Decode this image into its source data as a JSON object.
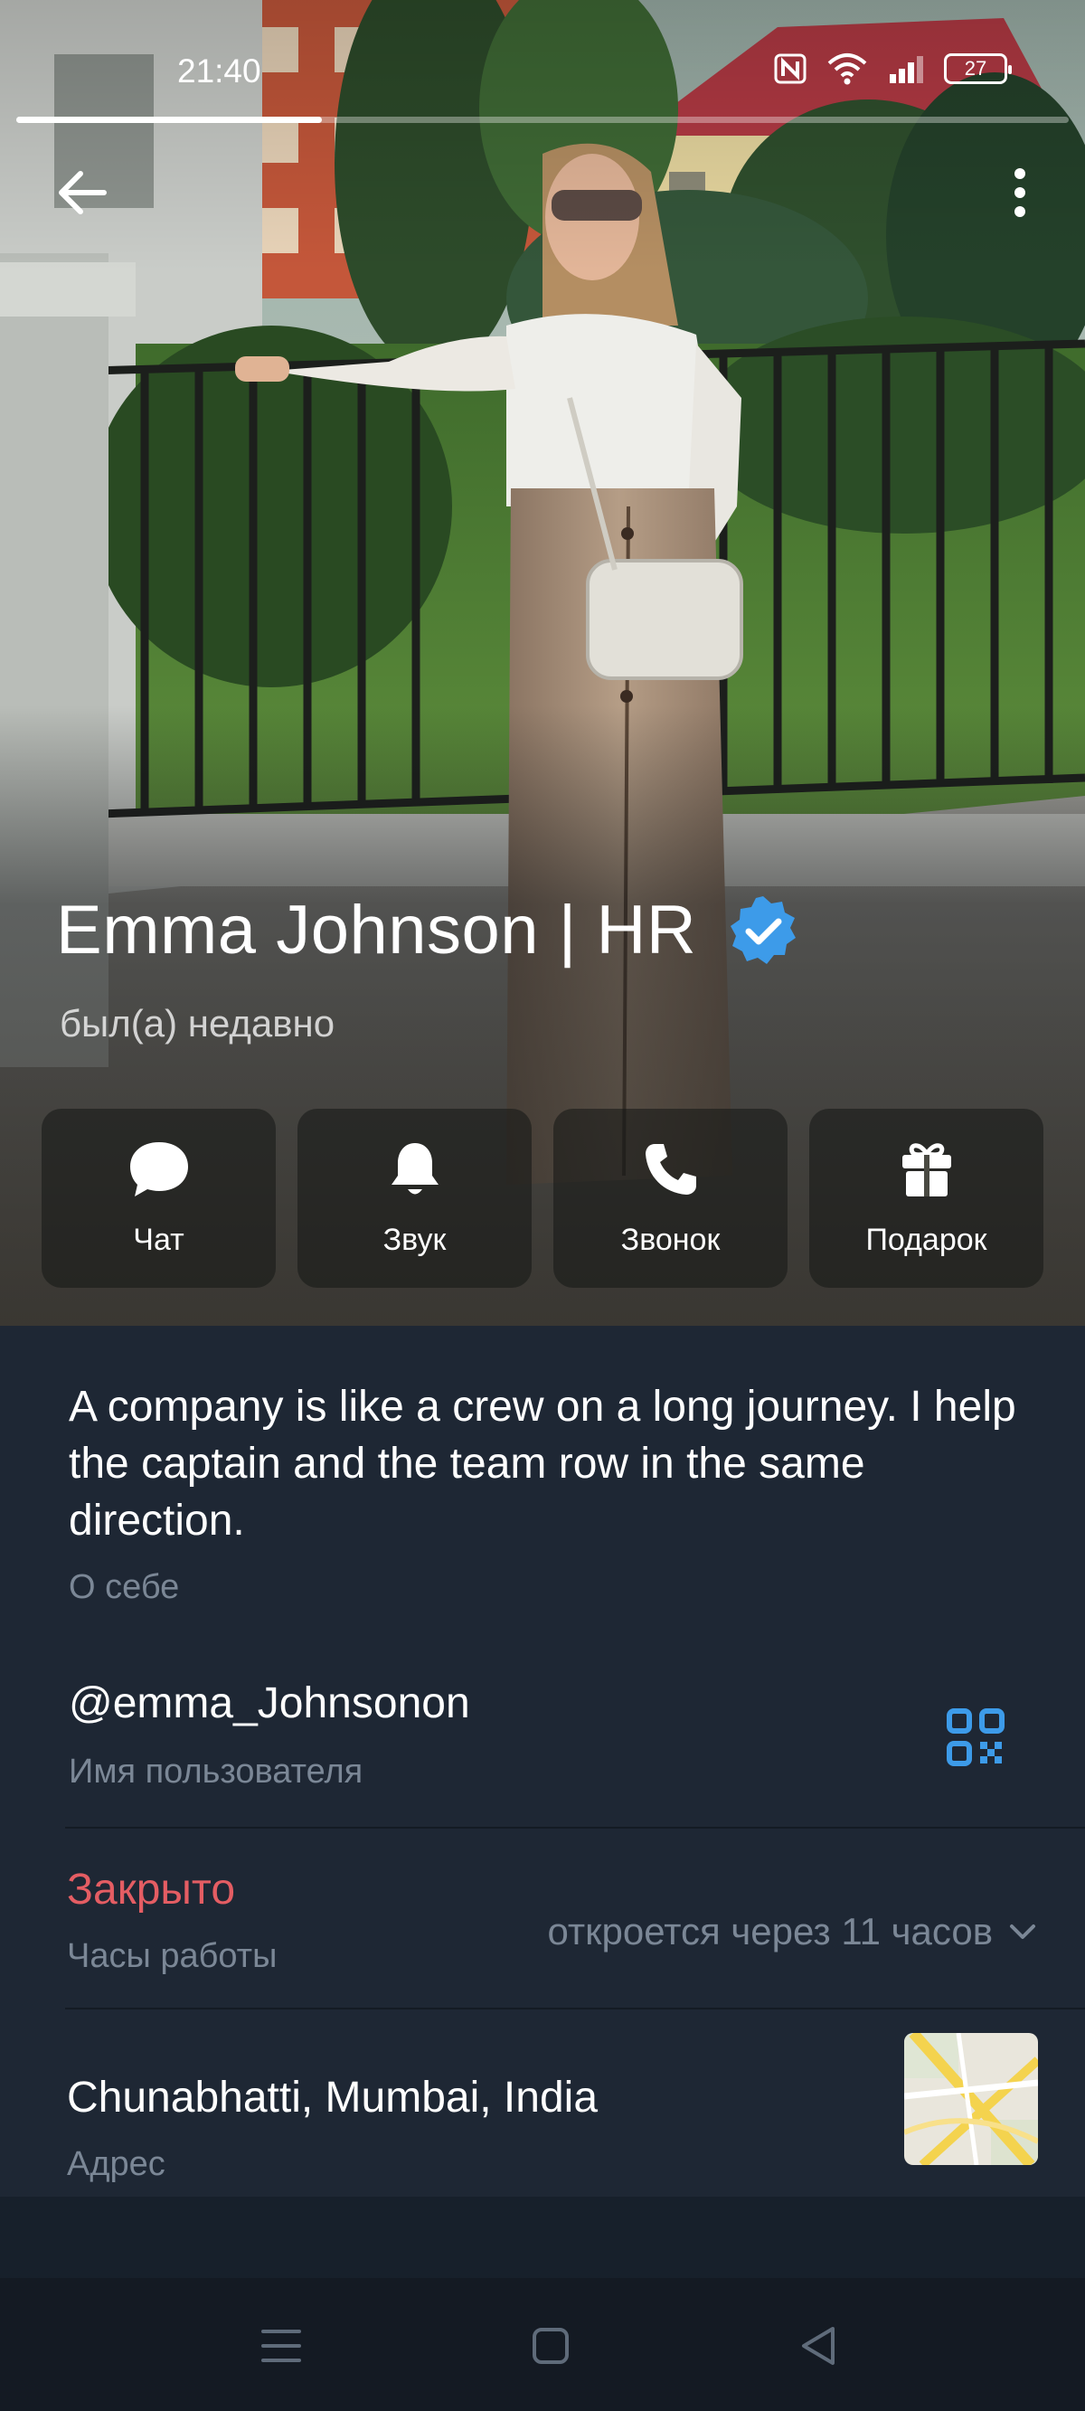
{
  "status_bar": {
    "time": "21:40",
    "battery": "27",
    "icons": [
      "nfc-icon",
      "wifi-icon",
      "signal-icon",
      "battery-icon"
    ]
  },
  "story": {
    "progress": 0.29
  },
  "profile": {
    "name": "Emma Johnson | HR",
    "verified": true,
    "last_seen": "был(а) недавно"
  },
  "actions": [
    {
      "label": "Чат",
      "icon": "chat-bubble-icon"
    },
    {
      "label": "Звук",
      "icon": "bell-icon"
    },
    {
      "label": "Звонок",
      "icon": "phone-icon"
    },
    {
      "label": "Подарок",
      "icon": "gift-icon"
    }
  ],
  "info": {
    "bio": "A company is like a crew on a long journey. I help the captain and the team row in the same direction.",
    "bio_caption": "О себе",
    "username": "@emma_Johnsonon",
    "username_caption": "Имя пользователя",
    "hours_status": "Закрыто",
    "hours_caption": "Часы работы",
    "hours_open_in": "откроется через 11 часов",
    "address": "Chunabhatti, Mumbai, India",
    "address_caption": "Адрес"
  },
  "colors": {
    "accent_blue": "#3d9be9",
    "closed_red": "#e45d63",
    "panel": "#1e2734",
    "caption": "#7b8796"
  },
  "nav": [
    "menu-icon",
    "home-icon",
    "back-triangle-icon"
  ]
}
